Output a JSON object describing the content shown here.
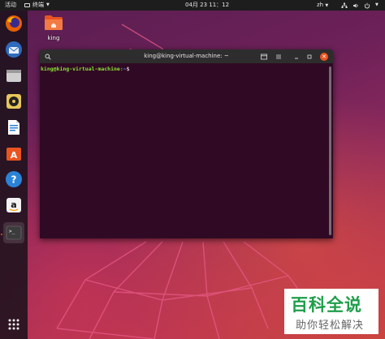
{
  "topbar": {
    "activities": "活动",
    "app_menu": "终端",
    "clock": "04月 23 11：12",
    "language": "zh",
    "icons": [
      "terminal-icon",
      "network-icon",
      "volume-icon",
      "power-icon"
    ]
  },
  "dock": {
    "items": [
      {
        "name": "firefox",
        "icon": "firefox-icon"
      },
      {
        "name": "thunderbird",
        "icon": "thunderbird-icon"
      },
      {
        "name": "files",
        "icon": "files-icon"
      },
      {
        "name": "rhythmbox",
        "icon": "rhythmbox-icon"
      },
      {
        "name": "libreoffice-writer",
        "icon": "writer-icon"
      },
      {
        "name": "ubuntu-software",
        "icon": "software-icon"
      },
      {
        "name": "help",
        "icon": "help-icon"
      },
      {
        "name": "amazon",
        "icon": "amazon-icon"
      },
      {
        "name": "terminal",
        "icon": "terminal-icon"
      }
    ],
    "apps_grid": "show-applications-icon"
  },
  "desktop": {
    "home_label": "king"
  },
  "terminal": {
    "title": "king@king-virtual-machine: ~",
    "prompt_user": "king@king-virtual-machine",
    "prompt_path": ":~",
    "prompt_symbol": "$"
  },
  "watermark": {
    "line1": "百科全说",
    "line2": "助你轻松解决"
  },
  "colors": {
    "terminal_bg": "#300a24",
    "accent": "#e95420",
    "prompt_user": "#8ae234",
    "prompt_path": "#729fcf"
  }
}
